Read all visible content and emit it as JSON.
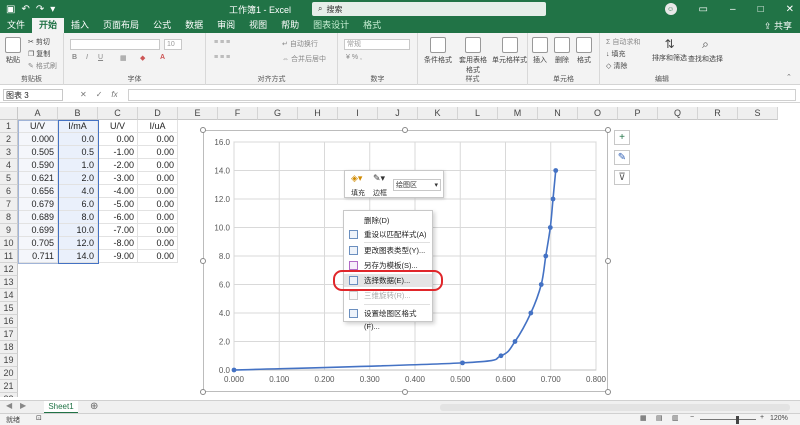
{
  "window": {
    "title": "工作簿1 - Excel",
    "search_placeholder": "搜索",
    "share_label": "共享",
    "colors": {
      "brand": "#217346",
      "series": "#4472c4",
      "highlight_ring": "#e0262a"
    }
  },
  "tabs": [
    "文件",
    "开始",
    "插入",
    "页面布局",
    "公式",
    "数据",
    "审阅",
    "视图",
    "帮助",
    "图表设计",
    "格式"
  ],
  "ribbon": {
    "clipboard": {
      "paste": "粘贴",
      "cut": "剪切",
      "copy": "复制",
      "format_painter": "格式刷",
      "label": "剪贴板"
    },
    "font": {
      "size": "10",
      "label": "字体"
    },
    "alignment": {
      "wrap": "自动换行",
      "merge": "合并后居中",
      "label": "对齐方式"
    },
    "number": {
      "format": "常规",
      "label": "数字"
    },
    "styles": {
      "conditional": "条件格式",
      "table": "套用表格格式",
      "cell": "单元格样式",
      "label": "样式"
    },
    "cells": {
      "insert": "插入",
      "delete": "删除",
      "format": "格式",
      "label": "单元格"
    },
    "editing": {
      "autosum": "自动求和",
      "fill": "填充",
      "clear": "清除",
      "sort": "排序和筛选",
      "find": "查找和选择",
      "label": "编辑"
    }
  },
  "formula_bar": {
    "name_box": "图表 3",
    "cancel": "✕",
    "enter": "✓",
    "fx": "fx",
    "formula": ""
  },
  "grid": {
    "columns": [
      "A",
      "B",
      "C",
      "D",
      "E",
      "F",
      "G",
      "H",
      "I",
      "J",
      "K",
      "L",
      "M",
      "N",
      "O",
      "P",
      "Q",
      "R",
      "S"
    ],
    "rows": [
      "1",
      "2",
      "3",
      "4",
      "5",
      "6",
      "7",
      "8",
      "9",
      "10",
      "11",
      "12",
      "13",
      "14",
      "15",
      "16",
      "17",
      "18",
      "19",
      "20",
      "21",
      "22",
      "23"
    ],
    "headers": [
      "U/V",
      "I/mA",
      "U/V",
      "I/uA"
    ],
    "data": [
      [
        "0.000",
        "0.0",
        "0.00",
        "0.00"
      ],
      [
        "0.505",
        "0.5",
        "-1.00",
        "0.00"
      ],
      [
        "0.590",
        "1.0",
        "-2.00",
        "0.00"
      ],
      [
        "0.621",
        "2.0",
        "-3.00",
        "0.00"
      ],
      [
        "0.656",
        "4.0",
        "-4.00",
        "0.00"
      ],
      [
        "0.679",
        "6.0",
        "-5.00",
        "0.00"
      ],
      [
        "0.689",
        "8.0",
        "-6.00",
        "0.00"
      ],
      [
        "0.699",
        "10.0",
        "-7.00",
        "0.00"
      ],
      [
        "0.705",
        "12.0",
        "-8.00",
        "0.00"
      ],
      [
        "0.711",
        "14.0",
        "-9.00",
        "0.00"
      ]
    ]
  },
  "chart_data": {
    "type": "scatter",
    "x": [
      0.0,
      0.505,
      0.59,
      0.621,
      0.656,
      0.679,
      0.689,
      0.699,
      0.705,
      0.711
    ],
    "y": [
      0.0,
      0.5,
      1.0,
      2.0,
      4.0,
      6.0,
      8.0,
      10.0,
      12.0,
      14.0
    ],
    "xlim": [
      0.0,
      0.8
    ],
    "ylim": [
      0.0,
      16.0
    ],
    "xticks": [
      "0.000",
      "0.100",
      "0.200",
      "0.300",
      "0.400",
      "0.500",
      "0.600",
      "0.700",
      "0.800"
    ],
    "yticks": [
      "0.0",
      "2.0",
      "4.0",
      "6.0",
      "8.0",
      "10.0",
      "12.0",
      "14.0",
      "16.0"
    ],
    "grid": true,
    "smooth": true,
    "markers": true
  },
  "mini_toolbar": {
    "fill": "填充",
    "border": "边框",
    "area": "绘图区"
  },
  "context_menu": [
    {
      "label": "删除(D)",
      "enabled": true
    },
    {
      "label": "重设以匹配样式(A)",
      "enabled": true
    },
    {
      "label": "更改图表类型(Y)...",
      "enabled": true
    },
    {
      "label": "另存为模板(S)...",
      "enabled": true
    },
    {
      "label": "选择数据(E)...",
      "enabled": true,
      "highlighted": true
    },
    {
      "label": "三维旋转(R)...",
      "enabled": false
    },
    {
      "label": "设置绘图区格式(F)...",
      "enabled": true
    }
  ],
  "sheet_tabs": [
    "Sheet1"
  ],
  "status": {
    "ready": "就绪",
    "zoom": "120%"
  }
}
